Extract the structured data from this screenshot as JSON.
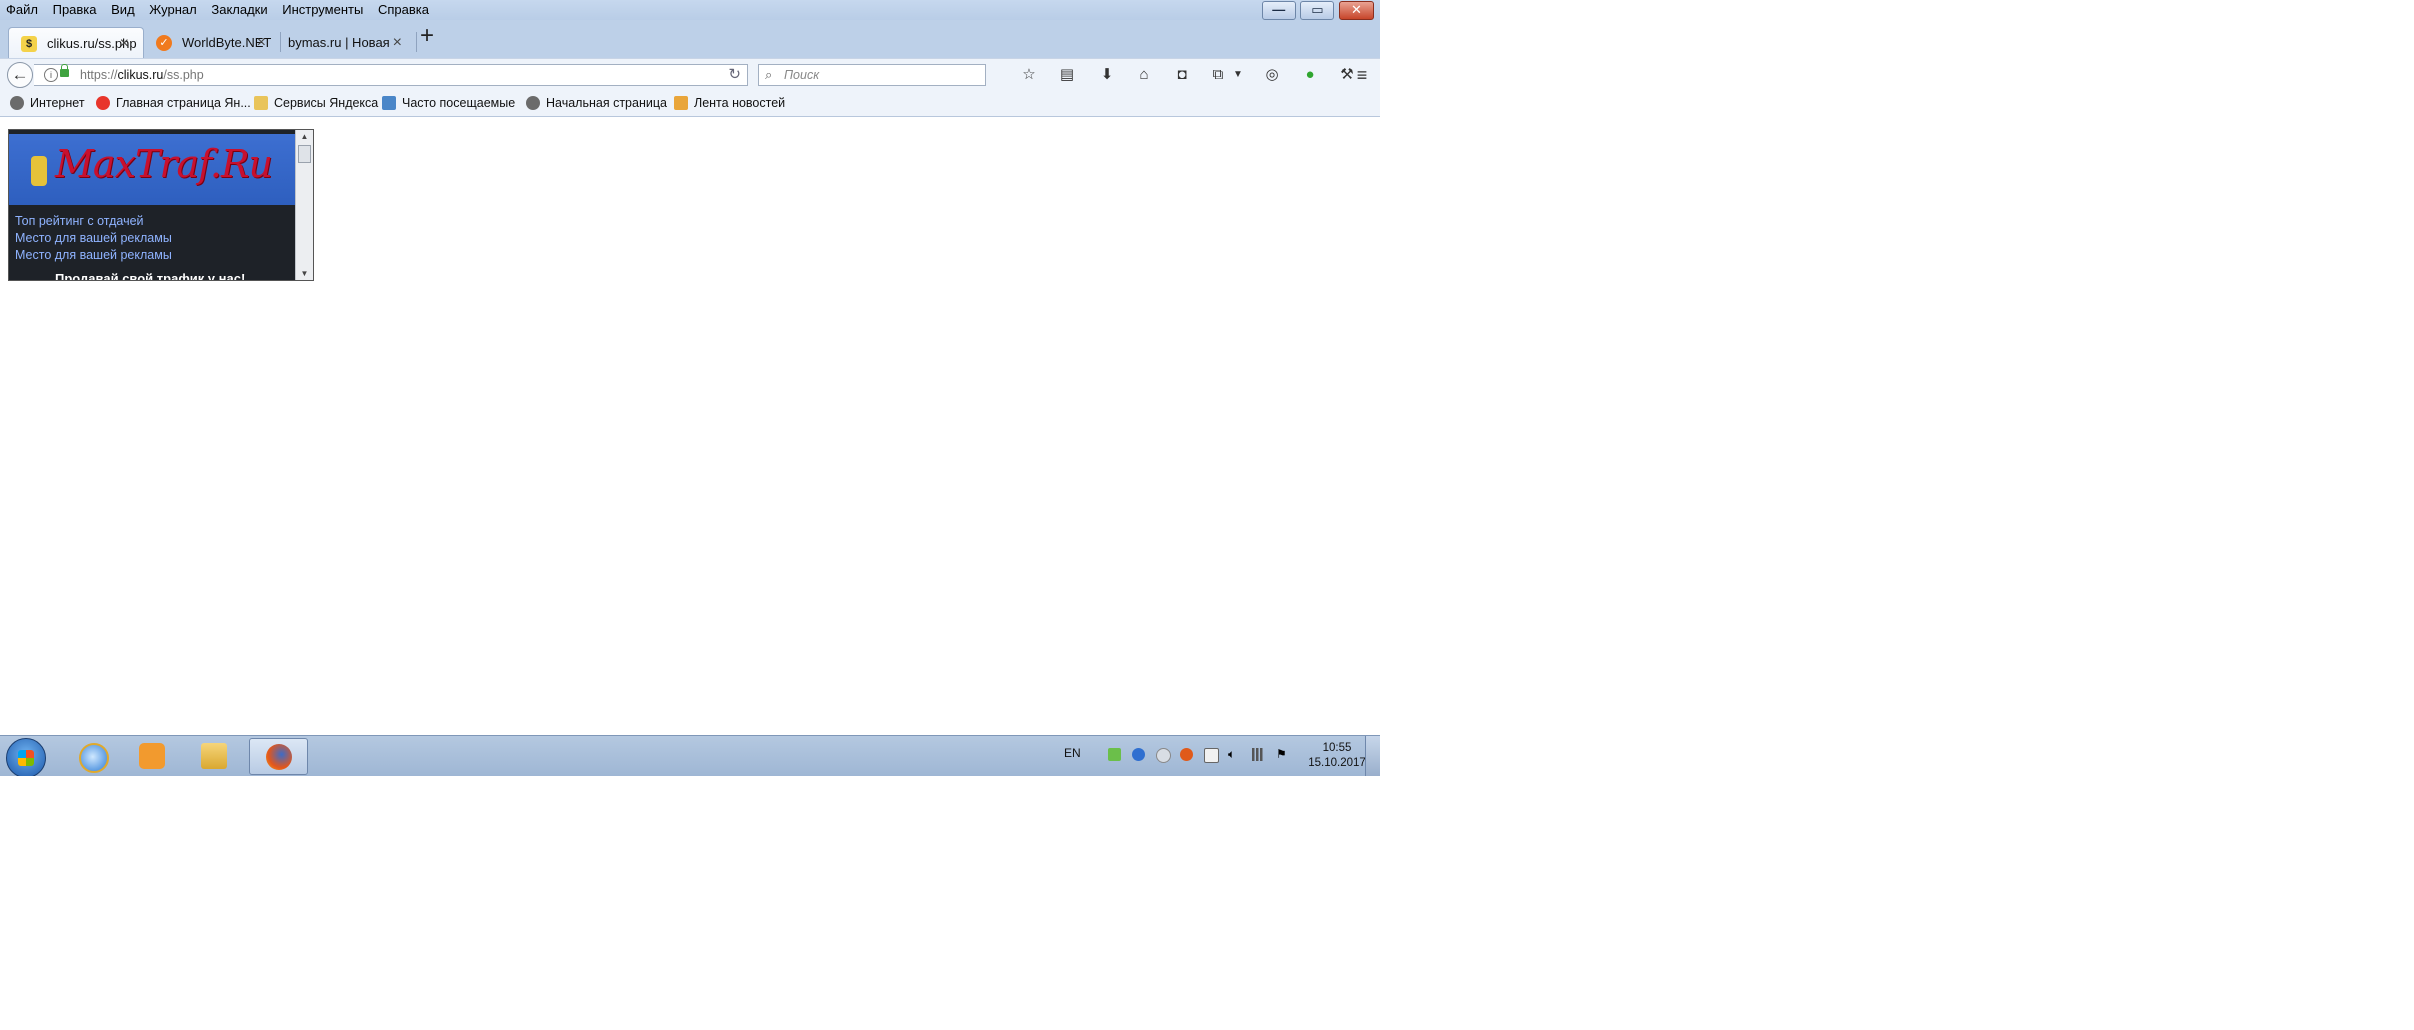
{
  "menu": {
    "items": [
      "Файл",
      "Правка",
      "Вид",
      "Журнал",
      "Закладки",
      "Инструменты",
      "Справка"
    ]
  },
  "window_buttons": {
    "minimize": "—",
    "maximize": "▭",
    "close": "✕"
  },
  "tabs": [
    {
      "title": "clikus.ru/ss.php",
      "close": "×",
      "favicon": "clikus-favicon",
      "active": true
    },
    {
      "title": "WorldByte.NET",
      "close": "×",
      "favicon": "worldbyte-favicon",
      "active": false
    },
    {
      "title": "bymas.ru | Новая тема",
      "close": "×",
      "favicon": "none",
      "active": false
    }
  ],
  "new_tab": "+",
  "address": {
    "scheme": "https://",
    "host": "clikus.ru",
    "path": "/ss.php"
  },
  "search": {
    "placeholder": "Поиск"
  },
  "bookmarks": [
    {
      "label": "Интернет",
      "icon": "globe-icon",
      "color": "#6b6b6b"
    },
    {
      "label": "Главная страница Ян...",
      "icon": "yandex-icon",
      "color": "#e8352b"
    },
    {
      "label": "Сервисы Яндекса",
      "icon": "folder-icon",
      "color": "#e9c45a"
    },
    {
      "label": "Часто посещаемые",
      "icon": "smart-folder-icon",
      "color": "#4a86c8"
    },
    {
      "label": "Начальная страница",
      "icon": "globe-icon",
      "color": "#6b6b6b"
    },
    {
      "label": "Лента новостей",
      "icon": "rss-folder-icon",
      "color": "#e9a53a"
    }
  ],
  "widget": {
    "logo": "MaxTraf.Ru",
    "links": [
      "Топ рейтинг с отдачей",
      "Место для вашей рекламы",
      "Место для вашей рекламы"
    ],
    "cta": "Продавай свой трафик у нас!"
  },
  "taskbar": {
    "language": "EN",
    "time": "10:55",
    "date": "15.10.2017"
  },
  "colors": {
    "accent": "#3d6fd1",
    "widget_bg": "#1e2228",
    "link": "#8fb3ff",
    "logo": "#c8102e"
  }
}
